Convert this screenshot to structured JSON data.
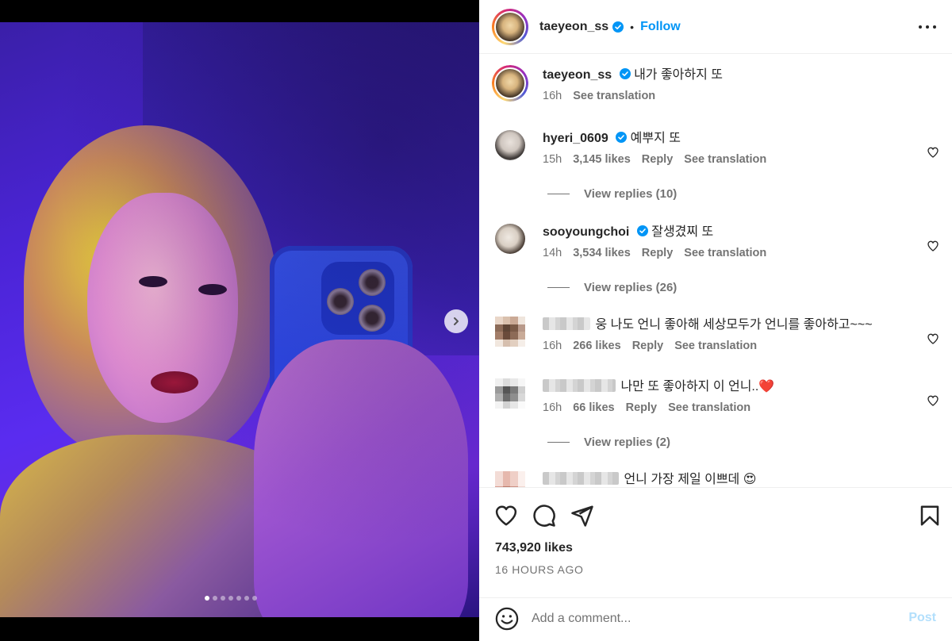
{
  "post": {
    "author": "taeyeon_ss",
    "follow_label": "Follow",
    "separator": "•",
    "image_count": 7,
    "active_image": 1
  },
  "caption": {
    "username": "taeyeon_ss",
    "text": "내가 좋아하지 또",
    "time": "16h",
    "see_translation": "See translation"
  },
  "comments": [
    {
      "username": "hyeri_0609",
      "verified": true,
      "text": "예뿌지 또",
      "time": "15h",
      "likes": "3,145 likes",
      "reply": "Reply",
      "see_translation": "See translation",
      "view_replies": "View replies (10)"
    },
    {
      "username": "sooyoungchoi",
      "verified": true,
      "text": "잘생겼찌 또",
      "time": "14h",
      "likes": "3,534 likes",
      "reply": "Reply",
      "see_translation": "See translation",
      "view_replies": "View replies (26)"
    },
    {
      "username": "",
      "verified": false,
      "text": "웅 나도 언니 좋아해 세상모두가 언니를 좋아하고~~~",
      "time": "16h",
      "likes": "266 likes",
      "reply": "Reply",
      "see_translation": "See translation"
    },
    {
      "username": "",
      "verified": false,
      "text": "나만 또 좋아하지 이 언니..❤️",
      "time": "16h",
      "likes": "66 likes",
      "reply": "Reply",
      "see_translation": "See translation",
      "view_replies": "View replies (2)"
    },
    {
      "username": "",
      "verified": false,
      "text": "언니 가장 제일 이쁘데 😍"
    }
  ],
  "actions": {
    "likes": "743,920 likes",
    "time_ago": "16 HOURS AGO"
  },
  "add_comment": {
    "placeholder": "Add a comment...",
    "post_label": "Post"
  },
  "colors": {
    "accent": "#0095f6",
    "verified": "#0095f6",
    "post_disabled": "#b2dffc",
    "secondary_text": "#737373"
  },
  "icons": [
    "verified-badge-icon",
    "more-options-icon",
    "heart-icon",
    "comment-icon",
    "share-icon",
    "bookmark-icon",
    "emoji-icon",
    "next-arrow-icon"
  ]
}
